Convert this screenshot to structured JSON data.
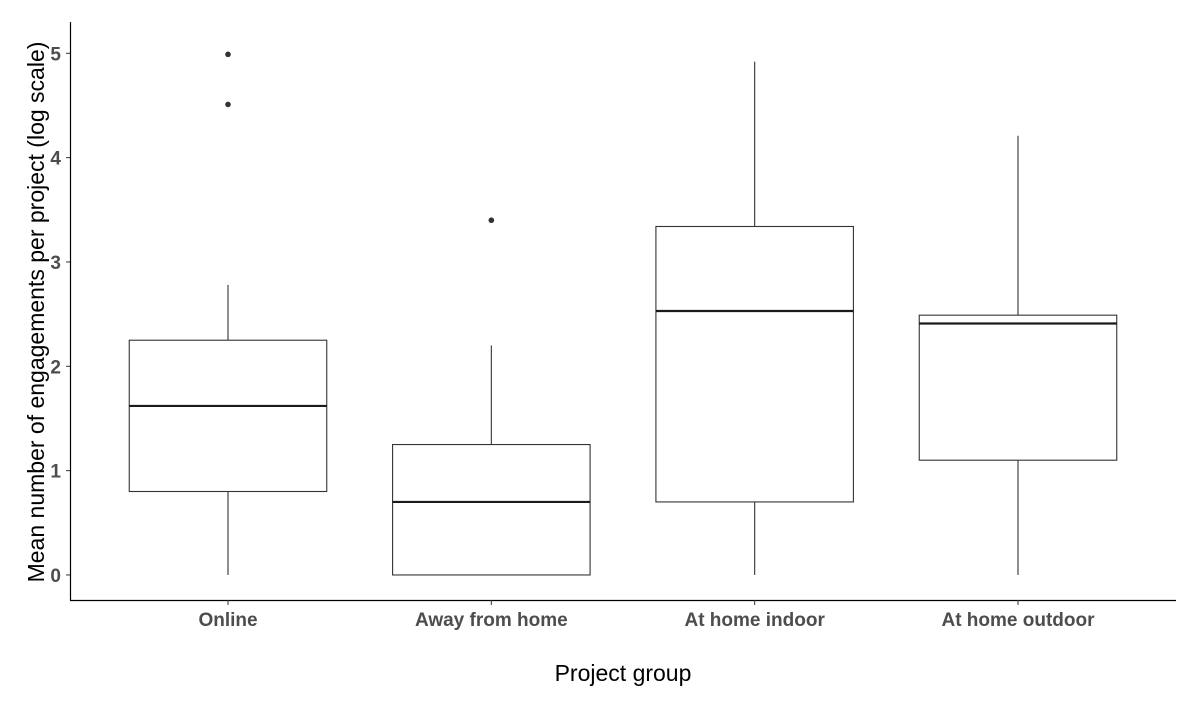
{
  "chart_data": {
    "type": "boxplot",
    "title": "",
    "xlabel": "Project group",
    "ylabel": "Mean number of engagements per project (log scale)",
    "ylim": [
      -0.24,
      5.3
    ],
    "yticks": [
      0,
      1,
      2,
      3,
      4,
      5
    ],
    "ytick_labels": [
      "0",
      "1",
      "2",
      "3",
      "4",
      "5"
    ],
    "grid": false,
    "legend": "none",
    "categories": [
      "Online",
      "Away from home",
      "At home indoor",
      "At home outdoor"
    ],
    "boxes": [
      {
        "name": "Online",
        "whisker_low": 0.0,
        "q1": 0.8,
        "median": 1.62,
        "q3": 2.25,
        "whisker_high": 2.78,
        "outliers": [
          4.51,
          4.99
        ]
      },
      {
        "name": "Away from home",
        "whisker_low": 0.0,
        "q1": 0.0,
        "median": 0.7,
        "q3": 1.25,
        "whisker_high": 2.2,
        "outliers": [
          3.4
        ]
      },
      {
        "name": "At home indoor",
        "whisker_low": 0.0,
        "q1": 0.7,
        "median": 2.53,
        "q3": 3.34,
        "whisker_high": 4.92,
        "outliers": []
      },
      {
        "name": "At home outdoor",
        "whisker_low": 0.0,
        "q1": 1.1,
        "median": 2.41,
        "q3": 2.49,
        "whisker_high": 4.21,
        "outliers": []
      }
    ],
    "colors": {
      "box_stroke": "#333333",
      "box_fill": "#ffffff",
      "outlier": "#333333",
      "axis": "#000000",
      "tick_text": "#4d4d4d"
    }
  }
}
